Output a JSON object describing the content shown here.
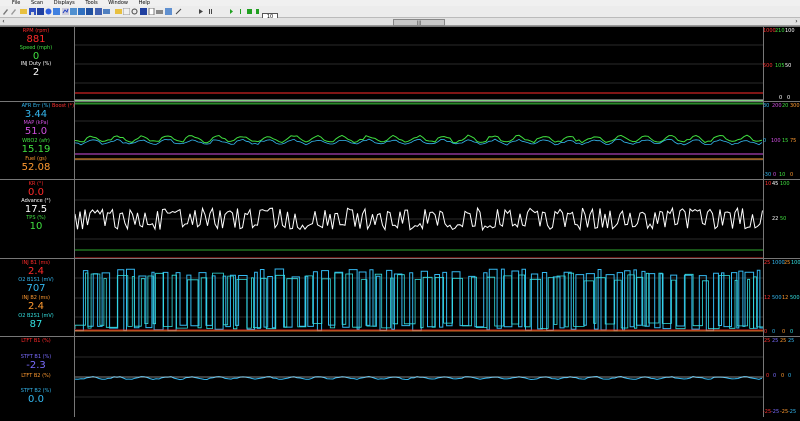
{
  "menu": [
    "File",
    "Scan",
    "Displays",
    "Tools",
    "Window",
    "Help"
  ],
  "toolbar": {
    "zoom": "10"
  },
  "scrollbar": {
    "left_arrow": "‹",
    "right_arrow": "›",
    "thumb": "|||"
  },
  "panels": [
    {
      "name": "engine",
      "labels": [
        {
          "name": "RPM (rpm)",
          "value": "881",
          "color": "#ff2a2a"
        },
        {
          "name": "Speed (mph)",
          "value": "0",
          "color": "#40e040"
        },
        {
          "name": "INJ Duty (%)",
          "value": "2",
          "color": "#ffffff"
        }
      ],
      "right": [
        {
          "text": "1000",
          "color": "#ff3030"
        },
        {
          "text": "210",
          "color": "#40e040"
        },
        {
          "text": "100",
          "color": "#ffffff"
        },
        {
          "text": "500",
          "color": "#ff3030"
        },
        {
          "text": "105",
          "color": "#40e040"
        },
        {
          "text": "50",
          "color": "#ffffff"
        },
        {
          "text": "0",
          "color": "#ffffff"
        },
        {
          "text": "0",
          "color": "#ffffff"
        }
      ]
    },
    {
      "name": "air-fuel",
      "labels": [
        {
          "name": "AFR Err (%)",
          "value": "3.44",
          "color": "#34b8f0"
        },
        {
          "name": "MAP (kPa)",
          "value": "51.0",
          "color": "#d050e0"
        },
        {
          "name": "WBO2 (afr)",
          "value": "15.19",
          "color": "#40e040"
        },
        {
          "name": "Fuel (gs)",
          "value": "52.08",
          "color": "#ff9a30"
        }
      ],
      "inline": {
        "text": "Boost (*)",
        "color": "#ff3030"
      },
      "right": [
        {
          "text": "30",
          "color": "#34b8f0"
        },
        {
          "text": "200",
          "color": "#d050e0"
        },
        {
          "text": "20",
          "color": "#40e040"
        },
        {
          "text": "300",
          "color": "#ff9a30"
        },
        {
          "text": "0",
          "color": "#34b8f0"
        },
        {
          "text": "100",
          "color": "#d050e0"
        },
        {
          "text": "15",
          "color": "#40e040"
        },
        {
          "text": "75",
          "color": "#ff9a30"
        },
        {
          "text": "-30",
          "color": "#34b8f0"
        },
        {
          "text": "0",
          "color": "#d050e0"
        },
        {
          "text": "10",
          "color": "#40e040"
        },
        {
          "text": "0",
          "color": "#ff9a30"
        }
      ]
    },
    {
      "name": "ignition",
      "labels": [
        {
          "name": "KR (°)",
          "value": "0.0",
          "color": "#ff2a2a"
        },
        {
          "name": "Advance (°)",
          "value": "17.5",
          "color": "#ffffff"
        },
        {
          "name": "TPS (%)",
          "value": "10",
          "color": "#40e040"
        }
      ],
      "right": [
        {
          "text": "10",
          "color": "#ff3030"
        },
        {
          "text": "45",
          "color": "#ffffff"
        },
        {
          "text": "100",
          "color": "#40e040"
        },
        {
          "text": "22",
          "color": "#ffffff"
        },
        {
          "text": "50",
          "color": "#40e040"
        }
      ]
    },
    {
      "name": "injectors",
      "labels": [
        {
          "name": "INJ B1 (ms)",
          "value": "2.4",
          "color": "#ff2a2a"
        },
        {
          "name": "O2 B1S1 (mV)",
          "value": "707",
          "color": "#34b8f0"
        },
        {
          "name": "INJ B2 (ms)",
          "value": "2.4",
          "color": "#ff9a30"
        },
        {
          "name": "O2 B2S1 (mV)",
          "value": "87",
          "color": "#34e0e0"
        }
      ],
      "right": [
        {
          "text": "25",
          "color": "#ff3030"
        },
        {
          "text": "1000",
          "color": "#34b8f0"
        },
        {
          "text": "25",
          "color": "#ff9a30"
        },
        {
          "text": "1000",
          "color": "#34e0e0"
        },
        {
          "text": "12",
          "color": "#ff3030"
        },
        {
          "text": "500",
          "color": "#34b8f0"
        },
        {
          "text": "12",
          "color": "#ff9a30"
        },
        {
          "text": "500",
          "color": "#34e0e0"
        },
        {
          "text": "0",
          "color": "#ff3030"
        },
        {
          "text": "0",
          "color": "#34b8f0"
        },
        {
          "text": "0",
          "color": "#ff9a30"
        },
        {
          "text": "0",
          "color": "#34e0e0"
        }
      ]
    },
    {
      "name": "fuel-trims",
      "labels": [
        {
          "name": "LTFT B1 (%)",
          "value": "",
          "color": "#ff2a2a"
        },
        {
          "name": "STFT B1 (%)",
          "value": "-2.3",
          "color": "#7a6cff"
        },
        {
          "name": "LTFT B2 (%)",
          "value": "",
          "color": "#ff9a30"
        },
        {
          "name": "STFT B2 (%)",
          "value": "0.0",
          "color": "#34b8f0"
        }
      ],
      "right": [
        {
          "text": "25",
          "color": "#ff3030"
        },
        {
          "text": "25",
          "color": "#7a6cff"
        },
        {
          "text": "25",
          "color": "#ff9a30"
        },
        {
          "text": "25",
          "color": "#34b8f0"
        },
        {
          "text": "0",
          "color": "#ff3030"
        },
        {
          "text": "0",
          "color": "#7a6cff"
        },
        {
          "text": "0",
          "color": "#ff9a30"
        },
        {
          "text": "0",
          "color": "#34b8f0"
        },
        {
          "text": "-25",
          "color": "#ff3030"
        },
        {
          "text": "-25",
          "color": "#7a6cff"
        },
        {
          "text": "-25",
          "color": "#ff9a30"
        },
        {
          "text": "-25",
          "color": "#34b8f0"
        }
      ]
    }
  ]
}
